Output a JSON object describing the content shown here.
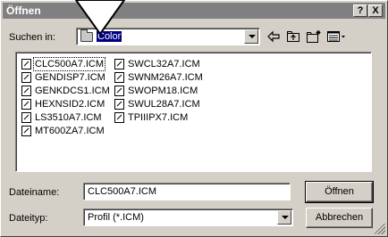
{
  "window": {
    "title": "Öffnen",
    "help_button": "?",
    "close_button": "X"
  },
  "lookin": {
    "label": "Suchen in:",
    "value": "Color"
  },
  "toolbar": {
    "back_icon": "back-arrow-icon",
    "up_icon": "up-folder-icon",
    "newfolder_icon": "new-folder-icon",
    "view_icon": "view-menu-icon"
  },
  "files": {
    "column1": [
      "CLC500A7.ICM",
      "GENDISP7.ICM",
      "GENKDCS1.ICM",
      "HEXNSID2.ICM",
      "LS3510A7.ICM",
      "MT600ZA7.ICM"
    ],
    "column2": [
      "SWCL32A7.ICM",
      "SWNM26A7.ICM",
      "SWOPM18.ICM",
      "SWUL28A7.ICM",
      "TPIIIPX7.ICM"
    ],
    "selected": "CLC500A7.ICM"
  },
  "filename": {
    "label": "Dateiname:",
    "value": "CLC500A7.ICM"
  },
  "filetype": {
    "label": "Dateityp:",
    "value": "Profil (*.ICM)"
  },
  "buttons": {
    "open": "Öffnen",
    "cancel": "Abbrechen"
  }
}
